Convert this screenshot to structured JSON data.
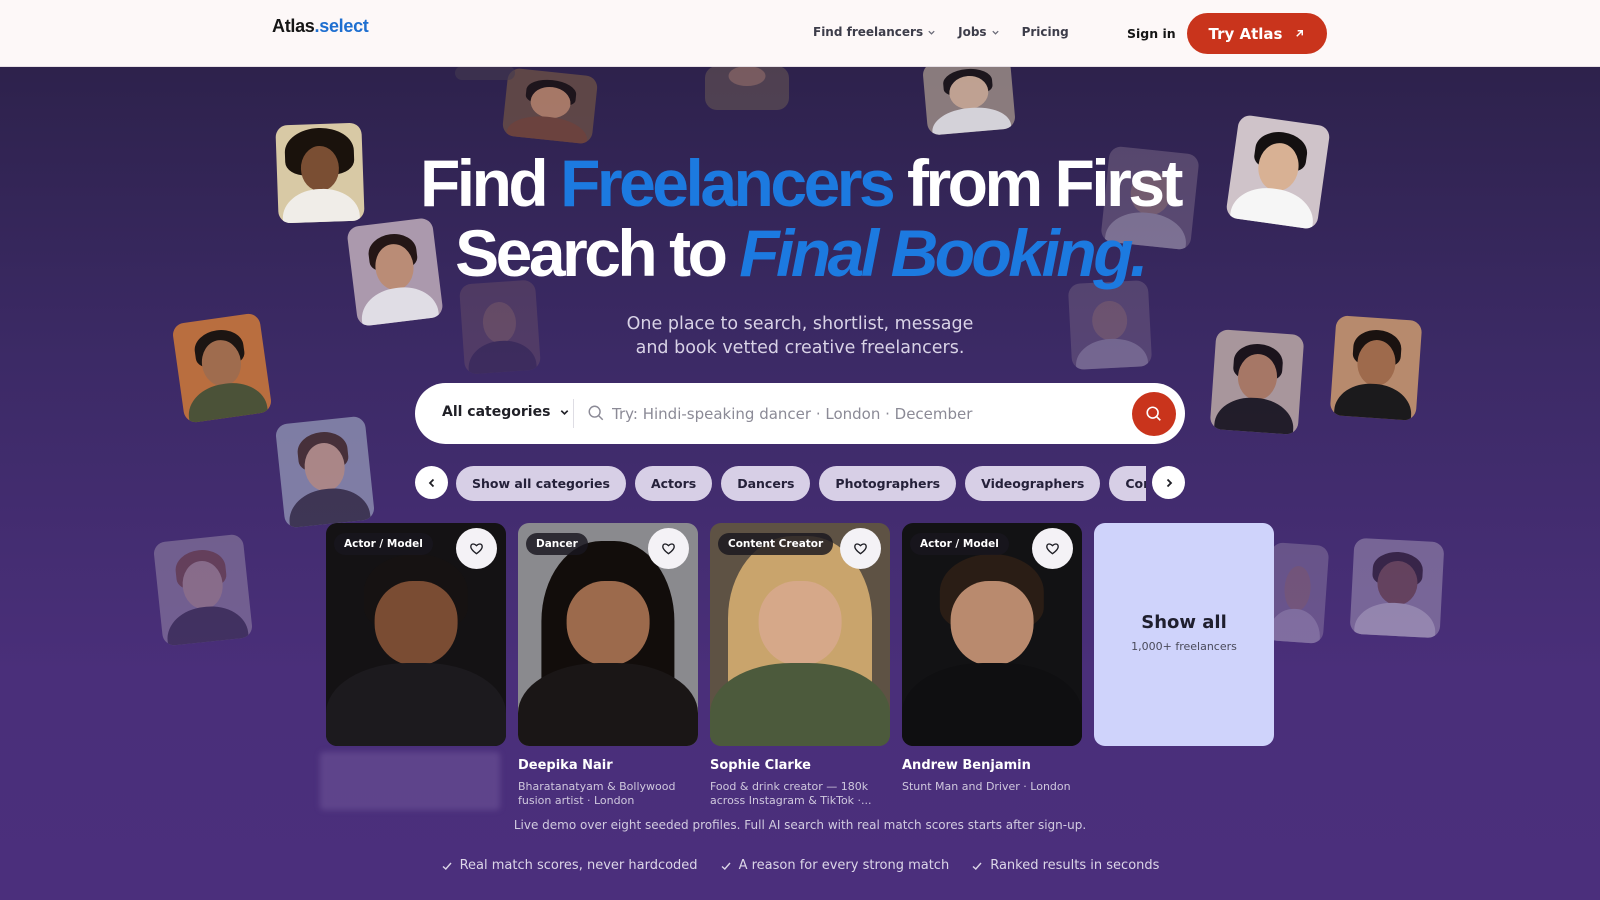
{
  "header": {
    "logo_main": "Atlas",
    "logo_accent": ".select",
    "nav": [
      {
        "label": "Find freelancers",
        "has_dropdown": true
      },
      {
        "label": "Jobs",
        "has_dropdown": true
      },
      {
        "label": "Pricing",
        "has_dropdown": false
      }
    ],
    "signin_label": "Sign in",
    "cta_label": "Try Atlas"
  },
  "hero": {
    "title_part1": "Find ",
    "title_highlight": "Freelancers",
    "title_part2": " from First",
    "title_line2_part1": "Search to ",
    "title_line2_highlight": "Final Booking.",
    "subtitle_line1": "One place to search, shortlist, message",
    "subtitle_line2": "and book vetted creative freelancers."
  },
  "search": {
    "category_label": "All categories",
    "placeholder": "Try: Hindi-speaking dancer · London · December",
    "value": ""
  },
  "chips": [
    "Show all categories",
    "Actors",
    "Dancers",
    "Photographers",
    "Videographers",
    "Content Creators"
  ],
  "cards": [
    {
      "tag": "Actor / Model",
      "name": "",
      "desc": ""
    },
    {
      "tag": "Dancer",
      "name": "Deepika Nair",
      "desc": "Bharatanatyam & Bollywood fusion artist · London"
    },
    {
      "tag": "Content Creator",
      "name": "Sophie Clarke",
      "desc": "Food & drink creator — 180k across Instagram & TikTok ·..."
    },
    {
      "tag": "Actor / Model",
      "name": "Andrew Benjamin",
      "desc": "Stunt Man and Driver · London"
    }
  ],
  "show_all": {
    "title": "Show all",
    "subtitle": "1,000+ freelancers"
  },
  "demo_note": "Live demo over eight seeded profiles. Full AI search with real match scores starts after sign-up.",
  "features": [
    "Real match scores, never hardcoded",
    "A reason for every strong match",
    "Ranked results in seconds"
  ],
  "colors": {
    "brand_accent": "#1e6fd0",
    "cta": "#c9341c",
    "chip_bg": "#d7cfe6",
    "show_all_bg": "#cfd3fb",
    "hero_bg": "#3c2a66"
  }
}
